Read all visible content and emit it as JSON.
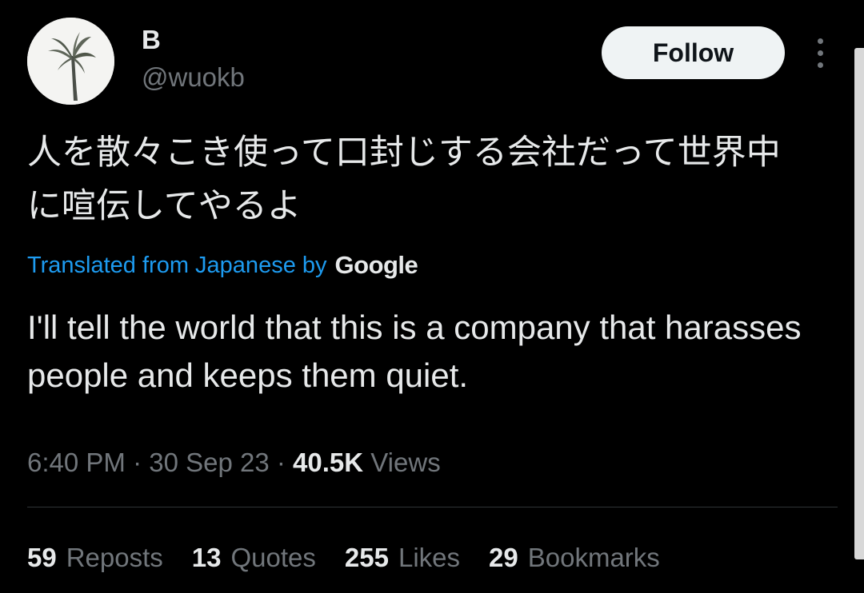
{
  "user": {
    "display_name": "B",
    "handle": "@wuokb"
  },
  "follow_button_label": "Follow",
  "tweet": {
    "text_original": "人を散々こき使って口封じする会社だって世界中\nに喧伝してやるよ",
    "translated_from": "Translated from Japanese by",
    "translation_provider": "Google",
    "text_translated": "I'll tell the world that this is a company that harasses people and keeps them quiet."
  },
  "meta": {
    "time": "6:40 PM",
    "date": "30 Sep 23",
    "separator": " · ",
    "views_count": "40.5K",
    "views_label": "Views"
  },
  "stats": {
    "reposts": {
      "count": "59",
      "label": "Reposts"
    },
    "quotes": {
      "count": "13",
      "label": "Quotes"
    },
    "likes": {
      "count": "255",
      "label": "Likes"
    },
    "bookmarks": {
      "count": "29",
      "label": "Bookmarks"
    }
  },
  "colors": {
    "background": "#000000",
    "primary_text": "#e7e9ea",
    "secondary_text": "#71767b",
    "link": "#1d9bf0",
    "follow_button_bg": "#eff3f4"
  },
  "icons": {
    "more": "more-vertical-icon"
  }
}
